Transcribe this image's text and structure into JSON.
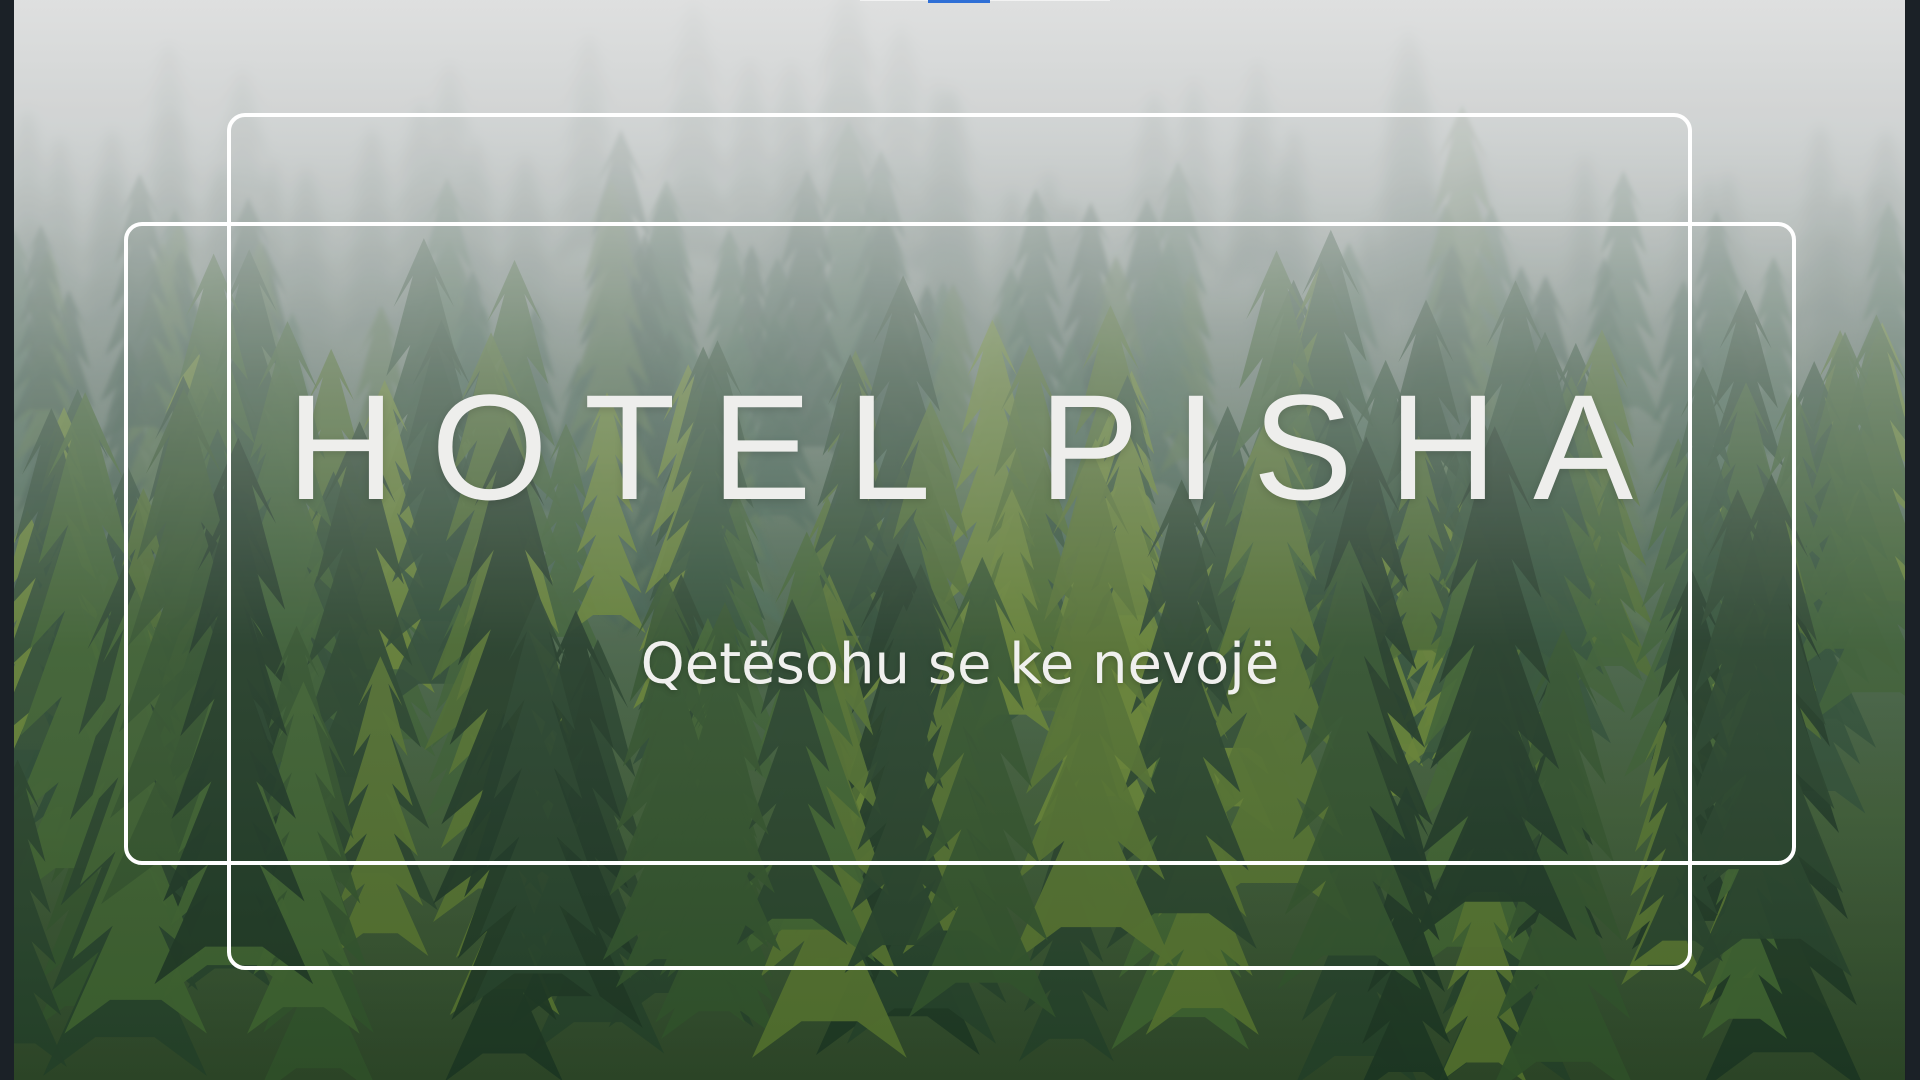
{
  "hero": {
    "title": "HOTEL PISHA",
    "subtitle": "Qetësohu se ke nevojë",
    "background": "misty-pine-forest"
  },
  "colors": {
    "frame": "#ffffff",
    "title_text": "#eeeeec",
    "accent": "#2f6fd6",
    "forest_dark": "#2f4a2a",
    "fog": "#e0e4e4"
  }
}
